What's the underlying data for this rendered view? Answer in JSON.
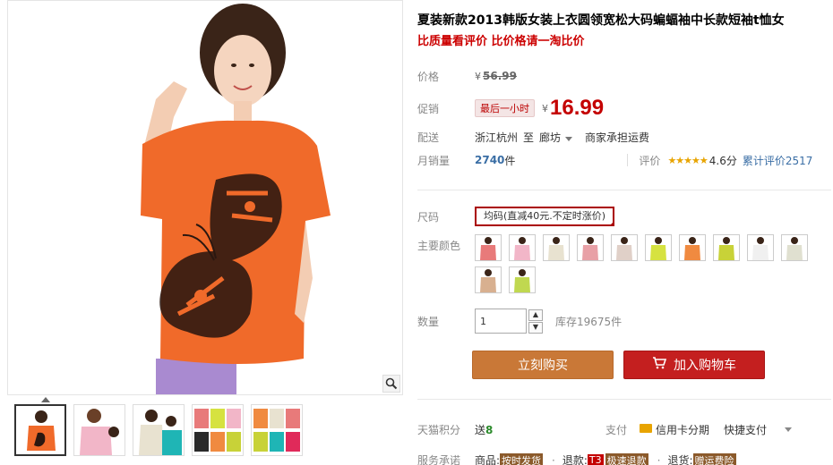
{
  "product": {
    "title": "夏装新款2013韩版女装上衣圆领宽松大码蝙蝠袖中长款短袖t恤女",
    "subtitle": "比质量看评价 比价格请一淘比价"
  },
  "price": {
    "label": "价格",
    "currency": "¥",
    "original": "56.99"
  },
  "promo": {
    "label": "促销",
    "tag": "最后一小时",
    "currency": "¥",
    "price": "16.99"
  },
  "shipping": {
    "label": "配送",
    "from": "浙江杭州",
    "to_word": "至",
    "to": "廊坊",
    "note": "商家承担运费"
  },
  "sales": {
    "label": "月销量",
    "value": "2740",
    "unit": "件",
    "rating_label": "评价",
    "stars": "★★★★★",
    "score": "4.6分",
    "reviews": "累计评价2517"
  },
  "size": {
    "label": "尺码",
    "option": "均码(直减40元.不定时涨价)"
  },
  "colors": {
    "label": "主要颜色",
    "swatch_colors": [
      "#e87a7a",
      "#f2b6c8",
      "#e8e2d0",
      "#e8a0a6",
      "#e0d0c8",
      "#d6e240",
      "#f08a40",
      "#c8d238",
      "#f0f0f0",
      "#e0e0d0",
      "#d8b090",
      "#c0d850"
    ]
  },
  "quantity": {
    "label": "数量",
    "value": "1",
    "up": "▲",
    "down": "▼",
    "stock": "库存19675件"
  },
  "buttons": {
    "buy": "立刻购买",
    "cart": "加入购物车"
  },
  "points": {
    "label": "天猫积分",
    "prefix": "送",
    "value": "8"
  },
  "payment": {
    "label": "支付",
    "card": "信用卡分期",
    "quick": "快捷支付"
  },
  "service": {
    "label": "服务承诺",
    "goods_label": "商品:",
    "goods_tag": "按时发货",
    "refund_label": "退款:",
    "refund_code": "T3",
    "refund_tag": "极速退款",
    "return_label": "退货:",
    "return_tag": "赠运费险"
  },
  "colors_theme": {
    "accent_red": "#c40000",
    "buy_button": "#c97837",
    "cart_button": "#c41f1f",
    "shirt_orange": "#f06a2a"
  },
  "icons": [
    "zoom-icon",
    "cart-icon",
    "card-icon",
    "chevron-down-icon"
  ]
}
